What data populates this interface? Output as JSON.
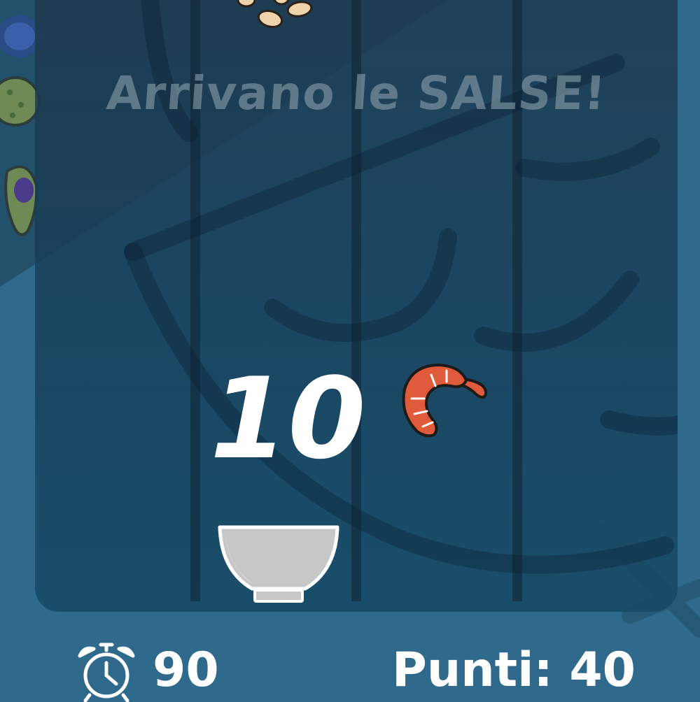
{
  "game": {
    "banner": "Arrivano le SALSE!",
    "countdown": "10",
    "timer_value": "90",
    "score_label": "Punti:",
    "score_value": "40"
  },
  "items": {
    "player": "bowl-icon",
    "falling": [
      "shrimp-icon",
      "sesame-seeds-icon"
    ],
    "hud": [
      "alarm-clock-icon"
    ]
  },
  "colors": {
    "background": "#2f6a8c",
    "board": "#1c3f57",
    "text": "#ffffff",
    "banner": "#96aab4",
    "shrimp": "#e05a3c"
  }
}
